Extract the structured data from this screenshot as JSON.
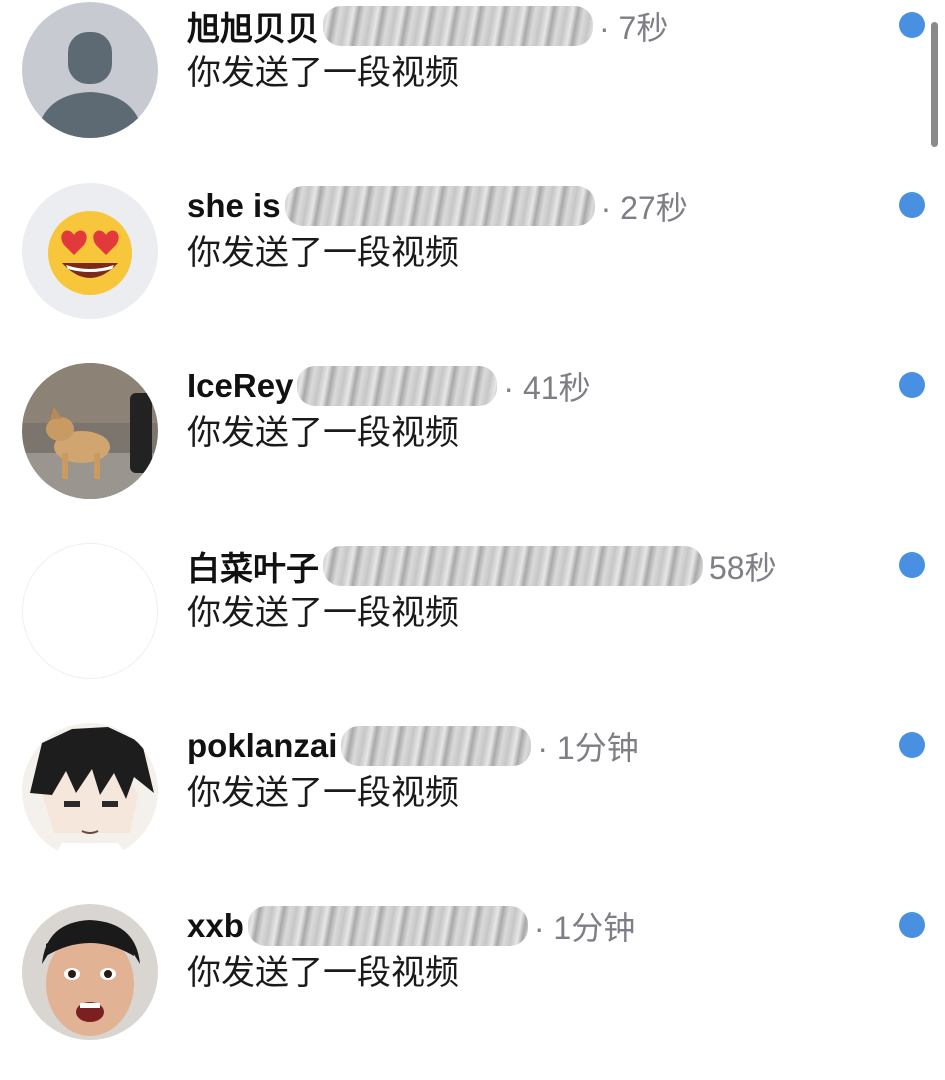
{
  "conversations": [
    {
      "name": "旭旭贝贝",
      "time": "· 7秒",
      "preview": "你发送了一段视频",
      "avatar": "default-person-avatar"
    },
    {
      "name": "she is",
      "time": "· 27秒",
      "preview": "你发送了一段视频",
      "avatar": "heart-eyes-emoji-avatar"
    },
    {
      "name": "IceRey",
      "time": "· 41秒",
      "preview": "你发送了一段视频",
      "avatar": "dog-photo-avatar"
    },
    {
      "name": "白菜叶子",
      "time": "58秒",
      "preview": "你发送了一段视频",
      "avatar": "blank-white-avatar"
    },
    {
      "name": "poklanzai",
      "time": "· 1分钟",
      "preview": "你发送了一段视频",
      "avatar": "anime-boy-avatar"
    },
    {
      "name": "xxb",
      "time": "· 1分钟",
      "preview": "你发送了一段视频",
      "avatar": "face-photo-avatar"
    }
  ],
  "colors": {
    "unread_dot": "#4a90e2",
    "time_text": "#7e7e86",
    "name_text": "#111111"
  }
}
